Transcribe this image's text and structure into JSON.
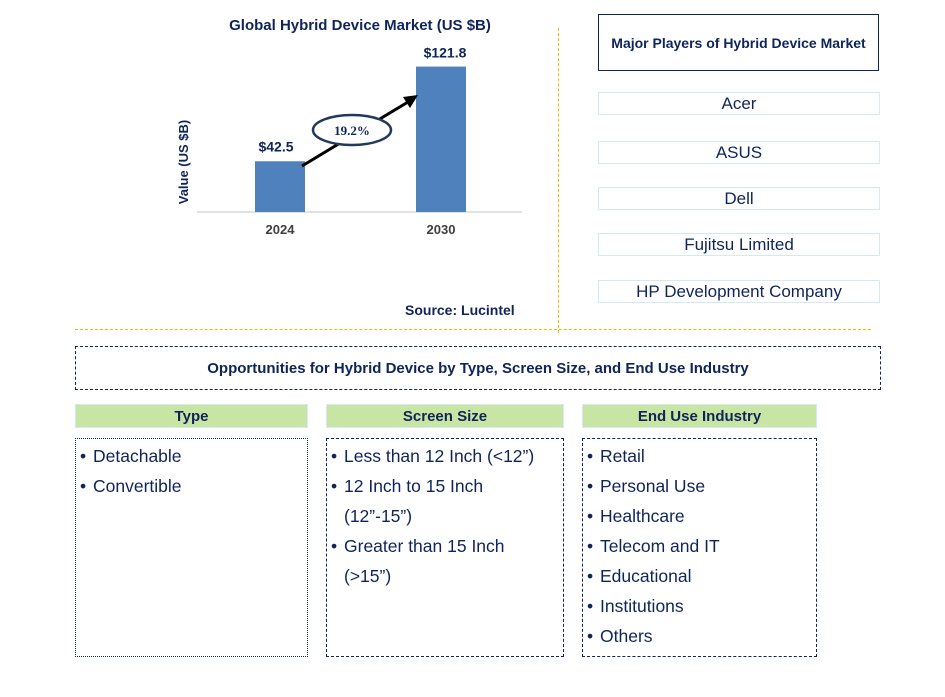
{
  "chart_data": {
    "type": "bar",
    "title": "Global Hybrid Device Market (US $B)",
    "xlabel": "",
    "ylabel": "Value (US $B)",
    "categories": [
      "2024",
      "2030"
    ],
    "values": [
      42.5,
      121.8
    ],
    "data_labels": [
      "$42.5",
      "$121.8"
    ],
    "annotation": {
      "type": "cagr-arrow",
      "label": "19.2%"
    },
    "ylim": [
      0,
      130
    ],
    "grid": false,
    "bar_color": "#4f81bd"
  },
  "source": "Source: Lucintel",
  "players": {
    "title": "Major Players of Hybrid Device Market",
    "items": [
      "Acer",
      "ASUS",
      "Dell",
      "Fujitsu Limited",
      "HP Development Company"
    ]
  },
  "opportunities": {
    "title": "Opportunities for Hybrid Device by Type, Screen Size, and End Use Industry",
    "categories": [
      {
        "header": "Type",
        "items": [
          "Detachable",
          "Convertible"
        ]
      },
      {
        "header": "Screen Size",
        "items": [
          "Less than 12 Inch (<12”)",
          "12 Inch to 15 Inch",
          "(12”-15”)",
          "Greater than 15 Inch",
          "(>15”)"
        ]
      },
      {
        "header": "End Use Industry",
        "items": [
          "Retail",
          "Personal Use",
          "Healthcare",
          "Telecom and IT",
          "Educational",
          "Institutions",
          "Others"
        ]
      }
    ]
  },
  "colors": {
    "text": "#0f2459",
    "bar": "#4f81bd",
    "header_green": "#c9e5a4",
    "divider": "#f5b800"
  }
}
